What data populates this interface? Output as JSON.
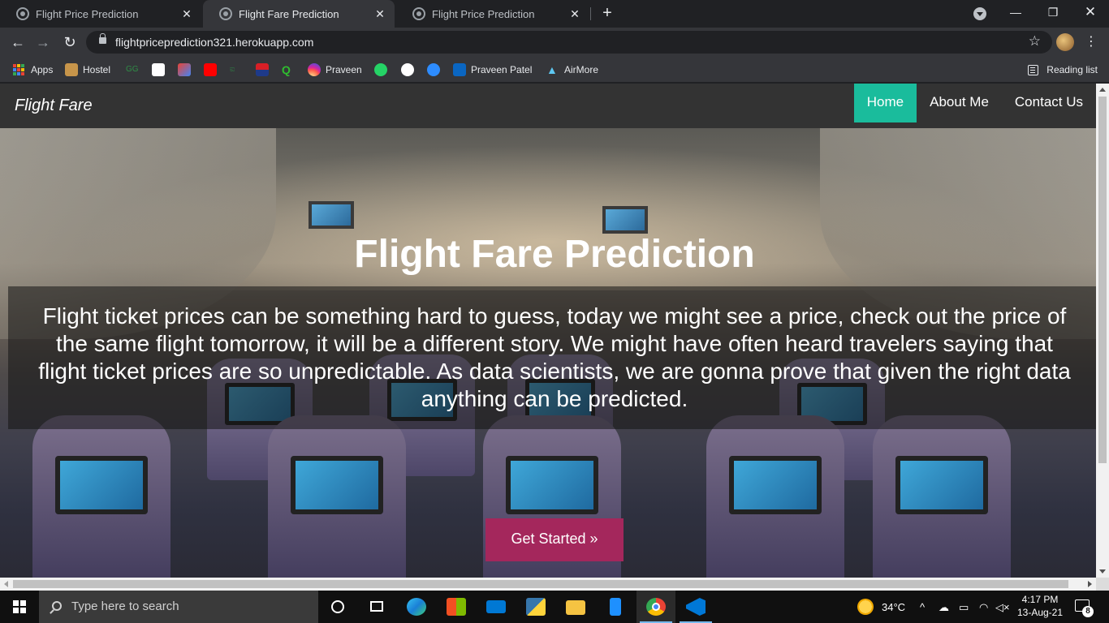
{
  "browser": {
    "tabs": [
      {
        "title": "Flight Price Prediction",
        "active": false
      },
      {
        "title": "Flight Fare Prediction",
        "active": true
      },
      {
        "title": "Flight Price Prediction",
        "active": false
      }
    ],
    "url": "flightpriceprediction321.herokuapp.com",
    "bookmarks": [
      "Apps",
      "Hostel",
      "Praveen",
      "Praveen Patel",
      "AirMore"
    ],
    "reading_list": "Reading list"
  },
  "site": {
    "brand": "Flight Fare",
    "nav": [
      "Home",
      "About Me",
      "Contact Us"
    ],
    "hero_title": "Flight Fare Prediction",
    "hero_text": "Flight ticket prices can be something hard to guess, today we might see a price, check out the price of the same flight tomorrow, it will be a different story. We might have often heard travelers saying that flight ticket prices are so unpredictable. As data scientists, we are gonna prove that given the right data anything can be predicted.",
    "cta": "Get Started »",
    "accent": "#1abc9c",
    "cta_color": "#a4275c"
  },
  "taskbar": {
    "search_placeholder": "Type here to search",
    "weather": "34°C",
    "time": "4:17 PM",
    "date": "13-Aug-21",
    "notifications": "8"
  }
}
